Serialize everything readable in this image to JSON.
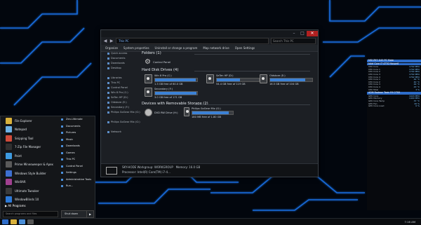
{
  "explorer": {
    "address": "This PC",
    "search_placeholder": "Search This PC",
    "commands": [
      "Organize",
      "System properties",
      "Uninstall or change a program",
      "Map network drive",
      "Open Settings"
    ],
    "nav": [
      "Quick access",
      "Documents",
      "Downloads",
      "Desktop",
      "",
      "Libraries",
      "This PC",
      "Control Panel",
      "Win 8 Pro (C:)",
      "SeTen HP (D:)",
      "Oldstore (E:)",
      "Secondary (F:)",
      "Philips GoGear Mix (G:)",
      "",
      "Philips GoGear Mix (G:)",
      "",
      "Network"
    ],
    "folders_header": "Folders (1)",
    "control_panel": "Control Panel",
    "hdd_header": "Hard Disk Drives (4)",
    "drives": [
      {
        "name": "Win 8 Pro (C:)",
        "free": "1.3 GB free of 60.0 GB",
        "used_fraction": 0.97
      },
      {
        "name": "SeTen HP (D:)",
        "free": "54.4 GB free of 119 GB",
        "used_fraction": 0.55
      },
      {
        "name": "Oldstore (E:)",
        "free": "16.5 GB free of 104 GB",
        "used_fraction": 0.84
      },
      {
        "name": "Secondary (F:)",
        "free": "3.0 GB free of 171 GB",
        "used_fraction": 0.98
      }
    ],
    "removable_header": "Devices with Removable Storage (2)",
    "dvd": "DVD RW Drive (H:)",
    "philips": {
      "name": "Philips GoGear Mix (G:)",
      "free": "180 MB free of 1.80 GB",
      "used_fraction": 0.9
    },
    "details": {
      "pc_name": "SKY-HODE",
      "workgroup_label": "Workgroup:",
      "workgroup": "WORKGROUP",
      "memory_label": "Memory:",
      "memory": "16.0 GB",
      "processor_label": "Processor:",
      "processor": "Intel(R) Core(TM) i7-4..."
    }
  },
  "start_menu": {
    "pinned": [
      {
        "label": "File Explorer",
        "color": "#d9b13b"
      },
      {
        "label": "Notepad",
        "color": "#6cb1e6"
      },
      {
        "label": "Snipping Tool",
        "color": "#d04a3a"
      },
      {
        "label": "7-Zip File Manager",
        "color": "#303030"
      },
      {
        "label": "Paint",
        "color": "#3d9ae0"
      },
      {
        "label": "Prime Minesweeper & Apex",
        "color": "#5a5a5a"
      },
      {
        "label": "Windows Style Builder",
        "color": "#3d6fd0"
      },
      {
        "label": "WinRAR",
        "color": "#a04090"
      },
      {
        "label": "Ultimate Tweaker",
        "color": "#3a3a3a"
      },
      {
        "label": "WindowBlinds 10",
        "color": "#2d7ad8"
      }
    ],
    "right": [
      "Zen-Ultimate",
      "Documents",
      "Pictures",
      "Music",
      "Downloads",
      "Games",
      "This PC",
      "Control Panel",
      "Settings",
      "Administrative Tools",
      "Run..."
    ],
    "all_programs": "All Programs",
    "search_placeholder": "Search programs and files",
    "shutdown": "Shut down"
  },
  "gadget": {
    "title": "MSI Z97-G45 PC Mate",
    "sections": [
      {
        "header": "Intel Core i7 4770 Haswell",
        "rows": [
          [
            "CPU Core",
            "1792 MHz"
          ],
          [
            "CPU Core 1",
            "1792 MHz"
          ],
          [
            "CPU Core 2",
            "1792 MHz"
          ],
          [
            "CPU Core 3",
            "1792 MHz"
          ],
          [
            "CPU Core 4",
            "1792 MHz"
          ],
          [
            "CPU Core 1",
            "42 °C"
          ],
          [
            "CPU Core 2",
            "40 °C"
          ],
          [
            "CPU Core 3",
            "44 °C"
          ],
          [
            "CPU Core 4",
            "43 °C"
          ],
          [
            "CPU Total",
            "3 %"
          ]
        ]
      },
      {
        "header": "ADM Radeon Toxic R9 270X",
        "rows": [
          [
            "GPU Core",
            "1020 MHz"
          ],
          [
            "GPU Memory",
            "1400 MHz"
          ],
          [
            "GPU Core Temp",
            "37 °C"
          ],
          [
            "GPU Fan",
            "20 %"
          ],
          [
            "GPU Core Load",
            "0 %"
          ]
        ]
      }
    ]
  },
  "taskbar": {
    "clock": "7:16 AM"
  },
  "colors": {
    "accent": "#2d6cc9",
    "neon": "#1a7dff"
  }
}
